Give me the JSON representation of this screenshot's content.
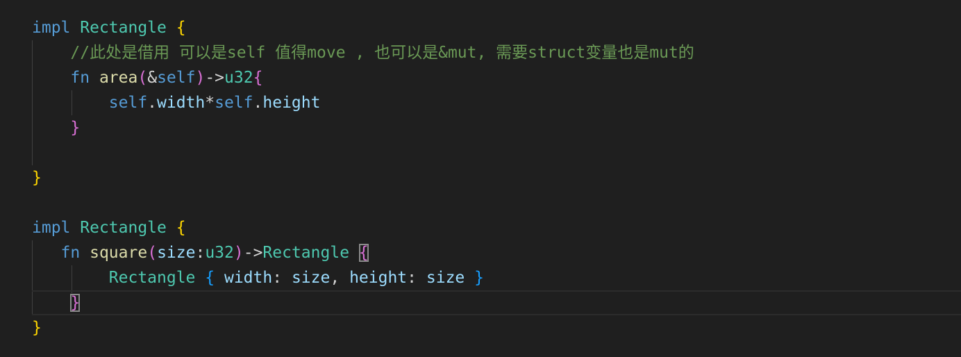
{
  "code": {
    "block1": {
      "impl_kw": "impl",
      "type_name": "Rectangle",
      "open_brace": "{",
      "comment": "//此处是借用 可以是self 值得move , 也可以是&mut, 需要struct变量也是mut的",
      "fn_kw": "fn",
      "fn_name": "area",
      "paren_open": "(",
      "amp": "&",
      "self_param": "self",
      "paren_close": ")",
      "arrow": "->",
      "ret_type": "u32",
      "fn_open_brace": "{",
      "body_self1": "self",
      "body_dot1": ".",
      "body_width": "width",
      "body_mul": "*",
      "body_self2": "self",
      "body_dot2": ".",
      "body_height": "height",
      "fn_close_brace": "}",
      "close_brace": "}"
    },
    "block2": {
      "impl_kw": "impl",
      "type_name": "Rectangle",
      "open_brace": "{",
      "fn_kw": "fn",
      "fn_name": "square",
      "paren_open": "(",
      "param_name": "size",
      "colon": ":",
      "param_type": "u32",
      "paren_close": ")",
      "arrow": "->",
      "ret_type": "Rectangle",
      "fn_open_brace": "{",
      "struct_name": "Rectangle",
      "struct_open": "{",
      "field1": "width",
      "colon1": ":",
      "val1": "size",
      "comma": ",",
      "field2": "height",
      "colon2": ":",
      "val2": "size",
      "struct_close": "}",
      "fn_close_brace": "}",
      "close_brace": "}"
    }
  }
}
